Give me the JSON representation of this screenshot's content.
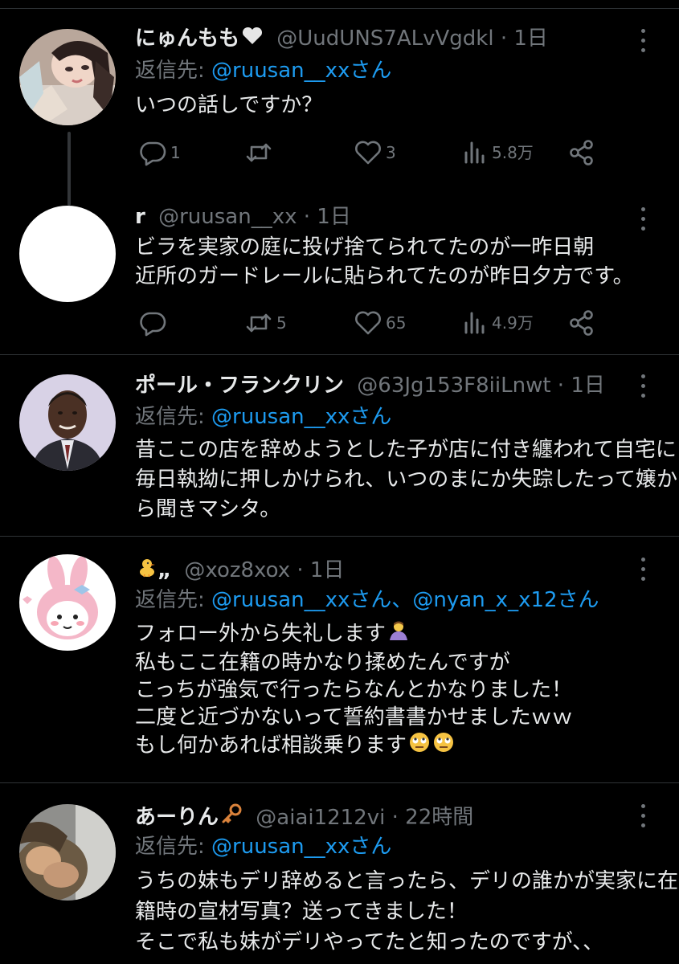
{
  "tweets": [
    {
      "display_name": "にゅんもも",
      "name_emoji": "heart",
      "handle": "@UudUNS7ALvVgdkl",
      "separator": "·",
      "time": "1日",
      "reply_prefix": "返信先: ",
      "reply_mentions": "@ruusan__xxさん",
      "lines": [
        "いつの話しですか？"
      ],
      "replies": "1",
      "retweets": "",
      "likes": "3",
      "views": "5.8万"
    },
    {
      "display_name": "r",
      "handle": "@ruusan__xx",
      "separator": "·",
      "time": "1日",
      "lines": [
        "ビラを実家の庭に投げ捨てられてたのが一昨日朝",
        "近所のガードレールに貼られてたのが昨日夕方です。"
      ],
      "replies": "",
      "retweets": "5",
      "likes": "65",
      "views": "4.9万"
    },
    {
      "display_name": "ポール・フランクリン",
      "handle": "@63Jg153F8iiLnwt",
      "separator": "·",
      "time": "1日",
      "reply_prefix": "返信先: ",
      "reply_mentions": "@ruusan__xxさん",
      "lines": [
        "昔ここの店を辞めようとした子が店に付き纏われて自宅に",
        "毎日執拗に押しかけられ、いつのまにか失踪したって嬢か",
        "ら聞きマシタ。"
      ]
    },
    {
      "display_name": "",
      "name_emoji": "chick",
      "name_suffix": "„",
      "handle": "@xoz8xox",
      "separator": "·",
      "time": "1日",
      "reply_prefix": "返信先: ",
      "reply_mentions": "@ruusan__xxさん、@nyan_x_x12さん",
      "lines": [
        "フォロー外から失礼します",
        "私もここ在籍の時かなり揉めたんですが",
        "こっちが強気で行ったらなんとかなりました！",
        "二度と近づかないって誓約書書かせましたｗｗ",
        "もし何かあれば相談乗ります"
      ]
    },
    {
      "display_name": "あーりん",
      "name_emoji": "key",
      "handle": "@aiai1212vi",
      "separator": "·",
      "time": "22時間",
      "reply_prefix": "返信先: ",
      "reply_mentions": "@ruusan__xxさん",
      "lines": [
        "うちの妹もデリ辞めると言ったら、デリの誰かが実家に在",
        "籍時の宣材写真？送ってきました！",
        "そこで私も妹がデリやってたと知ったのですが、、"
      ]
    }
  ],
  "icons": {
    "reply": "reply-icon",
    "retweet": "retweet-icon",
    "like": "heart-icon",
    "views": "views-icon",
    "share": "share-icon",
    "more": "more-icon"
  },
  "colors": {
    "background": "#000000",
    "text": "#e7e9ea",
    "muted": "#71767b",
    "link": "#1d9bf0",
    "divider": "#2f3336"
  }
}
